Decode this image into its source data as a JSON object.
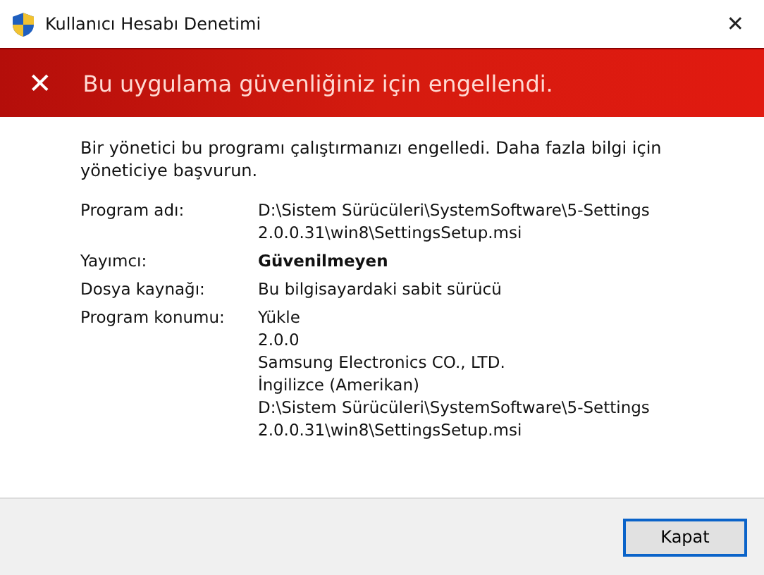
{
  "window": {
    "title": "Kullanıcı Hesabı Denetimi",
    "close": "✕"
  },
  "banner": {
    "icon": "✕",
    "text": "Bu uygulama güvenliğiniz için engellendi."
  },
  "message": "Bir yönetici bu programı çalıştırmanızı engelledi. Daha fazla bilgi için yöneticiye başvurun.",
  "details": [
    {
      "label": "Program adı:",
      "bold": false,
      "lines": [
        "D:\\Sistem Sürücüleri\\SystemSoftware\\5-Settings",
        "2.0.0.31\\win8\\SettingsSetup.msi"
      ]
    },
    {
      "label": "Yayımcı:",
      "bold": true,
      "lines": [
        "Güvenilmeyen"
      ]
    },
    {
      "label": "Dosya kaynağı:",
      "bold": false,
      "lines": [
        "Bu bilgisayardaki sabit sürücü"
      ]
    },
    {
      "label": "Program konumu:",
      "bold": false,
      "lines": [
        "Yükle",
        "2.0.0",
        "Samsung Electronics CO., LTD.",
        "İngilizce (Amerikan)",
        "D:\\Sistem Sürücüleri\\SystemSoftware\\5-Settings",
        "2.0.0.31\\win8\\SettingsSetup.msi"
      ]
    }
  ],
  "buttons": [
    "Kapat"
  ]
}
